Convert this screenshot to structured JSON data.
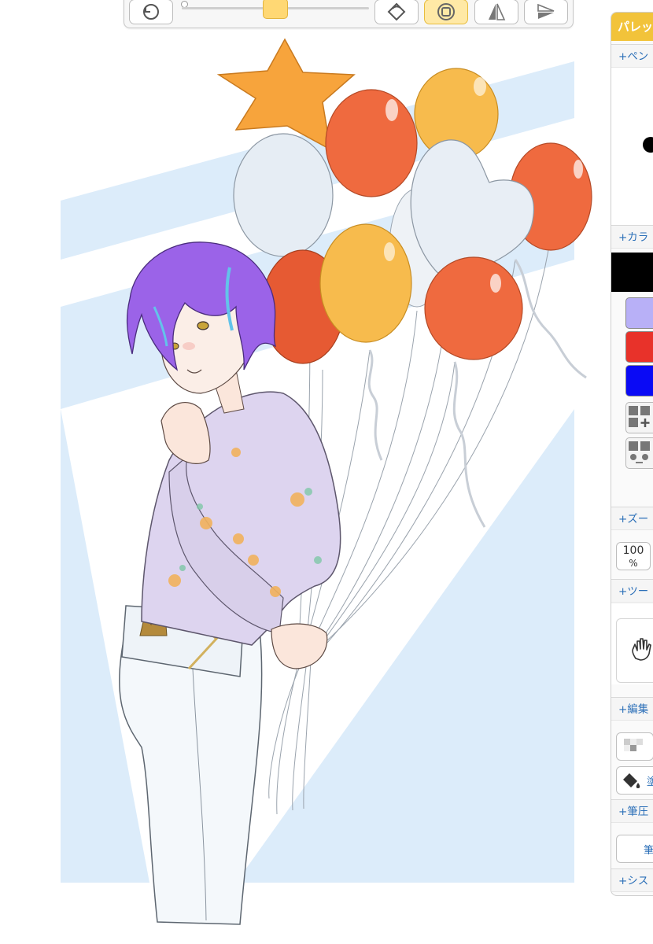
{
  "toolbar": {
    "buttons": [
      {
        "name": "undo-icon",
        "active": false
      },
      {
        "name": "rotate-icon",
        "active": false
      },
      {
        "name": "pen-shape-icon",
        "active": true
      },
      {
        "name": "flip-vertical-icon",
        "active": false
      },
      {
        "name": "flip-horizontal-icon",
        "active": false
      }
    ],
    "size_slider": {
      "value_fraction": 0.5
    }
  },
  "canvas": {
    "background": "#ffffff",
    "backdrop_color": "#dcecfa",
    "hair_color": "#9b63e8",
    "shirt_color": "#ddd4ef",
    "balloon_colors": {
      "orange": "#ef6a3f",
      "yellow": "#f7bb4d",
      "white": "#e6edf4"
    }
  },
  "palette": {
    "title": "パレッ",
    "header_color": "#f2c33a",
    "sections": {
      "pen": "+ペン",
      "color": "+カラ",
      "zoom": "+ズー",
      "tool": "+ツー",
      "edit": "+編集",
      "pressure": "+筆圧",
      "system": "+シス"
    },
    "current_color": "#000000",
    "swatches": [
      "#b8b0f7",
      "#e8322a",
      "#0a0af5"
    ],
    "zoom_value": "100",
    "zoom_unit": "%",
    "fill_button_label": "塗",
    "pressure_button_label": "筆"
  }
}
